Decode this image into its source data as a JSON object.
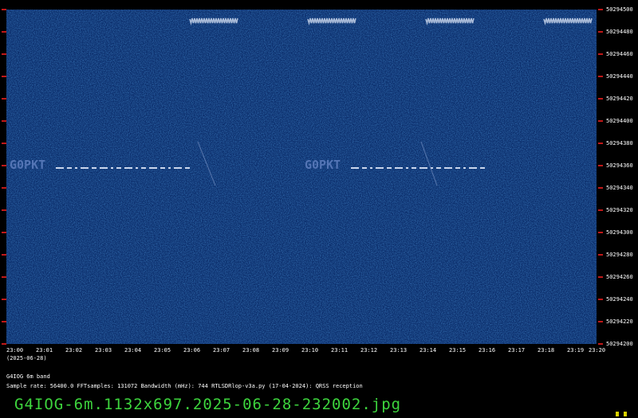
{
  "chart_data": {
    "type": "heatmap",
    "title": "",
    "date_label": "(2025-06-28)",
    "x_ticks": [
      "23:00",
      "23:01",
      "23:02",
      "23:03",
      "23:04",
      "23:05",
      "23:06",
      "23:07",
      "23:08",
      "23:09",
      "23:10",
      "23:11",
      "23:12",
      "23:13",
      "23:14",
      "23:15",
      "23:16",
      "23:17",
      "23:18",
      "23:19",
      "23:20"
    ],
    "y_ticks": [
      "50294500",
      "50294480",
      "50294460",
      "50294440",
      "50294420",
      "50294400",
      "50294380",
      "50294360",
      "50294340",
      "50294320",
      "50294300",
      "50294280",
      "50294260",
      "50294240",
      "50294220",
      "50294200"
    ],
    "xlim": [
      "23:00",
      "23:20"
    ],
    "ylim": [
      50294200,
      50294500
    ],
    "signals": [
      {
        "label": "G0PKT",
        "start": "23:00",
        "end": "23:07",
        "freq": 50294360
      },
      {
        "label": "G0PKT",
        "start": "23:10",
        "end": "23:17",
        "freq": 50294360
      }
    ],
    "bursts": [
      {
        "start": "23:06",
        "end": "23:08",
        "freq": 50294490
      },
      {
        "start": "23:10",
        "end": "23:12",
        "freq": 50294490
      },
      {
        "start": "23:14",
        "end": "23:16",
        "freq": 50294490
      },
      {
        "start": "23:18",
        "end": "23:20",
        "freq": 50294490
      }
    ],
    "background_color": "#0b2d6b",
    "tick_mark_color": "#c01818"
  },
  "info": {
    "station": "G4IOG 6m band",
    "params": "Sample rate: 56400.0    FFTsamples: 131072    Bandwidth (mHz): 744         RTLSDRlop-v3a.py (17-04-2024): QRSS reception"
  },
  "filename": "G4IOG-6m.1132x697.2025-06-28-232002.jpg",
  "colors": {
    "filename": "#3dd43d",
    "corner": "#d8d000"
  }
}
